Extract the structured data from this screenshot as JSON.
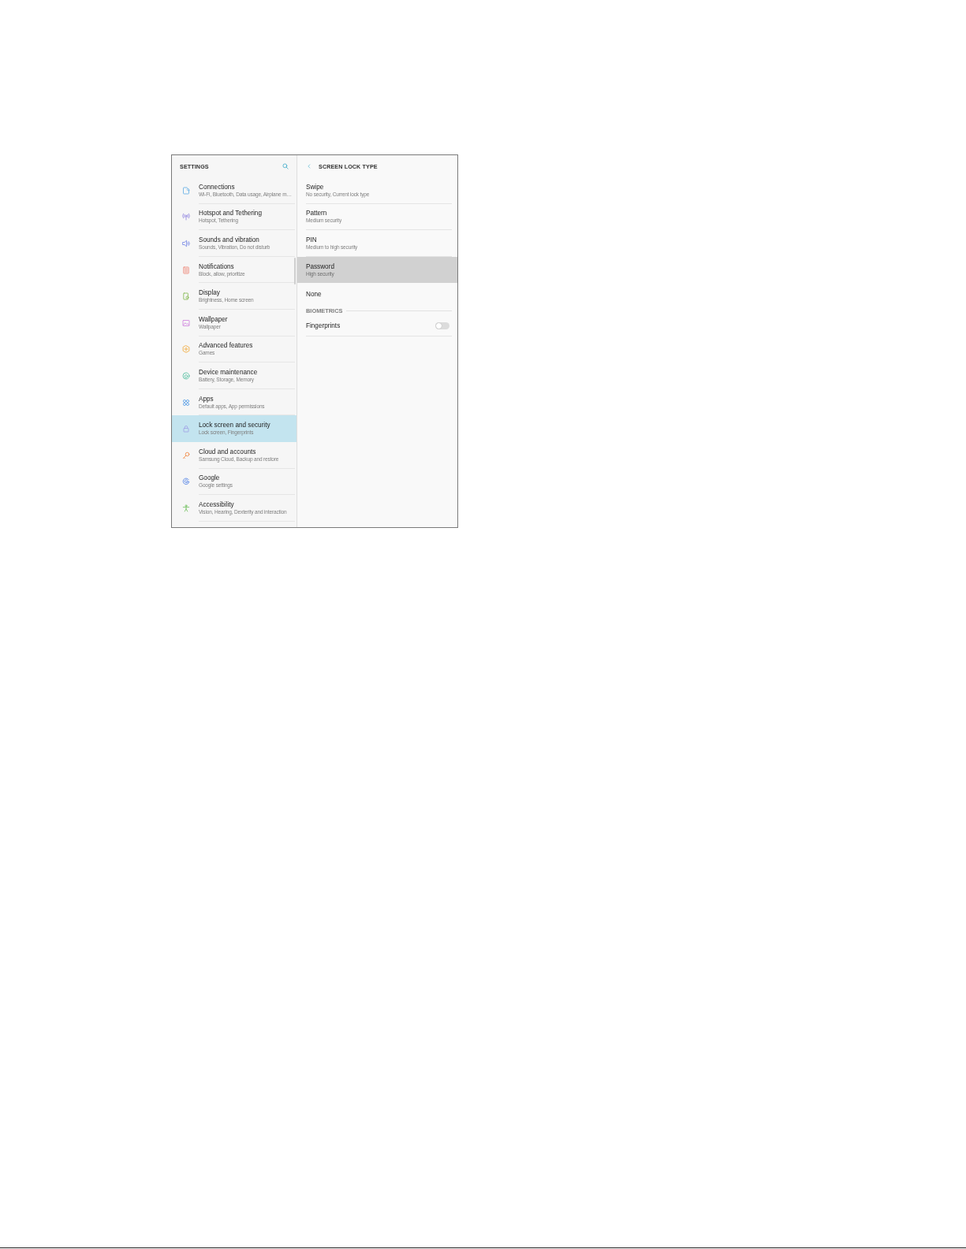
{
  "settings_panel": {
    "title": "SETTINGS",
    "items": [
      {
        "title": "Connections",
        "subtitle": "Wi-Fi, Bluetooth, Data usage, Airplane m…",
        "selected": false
      },
      {
        "title": "Hotspot and Tethering",
        "subtitle": "Hotspot, Tethering",
        "selected": false
      },
      {
        "title": "Sounds and vibration",
        "subtitle": "Sounds, Vibration, Do not disturb",
        "selected": false
      },
      {
        "title": "Notifications",
        "subtitle": "Block, allow, prioritize",
        "selected": false
      },
      {
        "title": "Display",
        "subtitle": "Brightness, Home screen",
        "selected": false
      },
      {
        "title": "Wallpaper",
        "subtitle": "Wallpaper",
        "selected": false
      },
      {
        "title": "Advanced features",
        "subtitle": "Games",
        "selected": false
      },
      {
        "title": "Device maintenance",
        "subtitle": "Battery, Storage, Memory",
        "selected": false
      },
      {
        "title": "Apps",
        "subtitle": "Default apps, App permissions",
        "selected": false
      },
      {
        "title": "Lock screen and security",
        "subtitle": "Lock screen, Fingerprints",
        "selected": true
      },
      {
        "title": "Cloud and accounts",
        "subtitle": "Samsung Cloud, Backup and restore",
        "selected": false
      },
      {
        "title": "Google",
        "subtitle": "Google settings",
        "selected": false
      },
      {
        "title": "Accessibility",
        "subtitle": "Vision, Hearing, Dexterity and interaction",
        "selected": false
      }
    ]
  },
  "screen_lock_panel": {
    "title": "SCREEN LOCK TYPE",
    "options": [
      {
        "title": "Swipe",
        "subtitle": "No security, Current lock type",
        "selected": false
      },
      {
        "title": "Pattern",
        "subtitle": "Medium security",
        "selected": false
      },
      {
        "title": "PIN",
        "subtitle": "Medium to high security",
        "selected": false
      },
      {
        "title": "Password",
        "subtitle": "High security",
        "selected": true
      },
      {
        "title": "None",
        "selected": false
      }
    ],
    "sections": [
      {
        "heading": "BIOMETRICS",
        "items": [
          {
            "label": "Fingerprints",
            "on": false
          }
        ]
      }
    ]
  }
}
